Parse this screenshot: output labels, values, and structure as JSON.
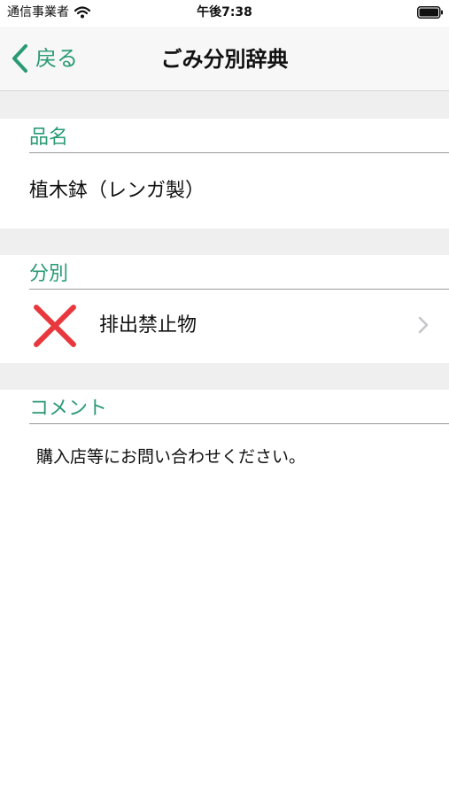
{
  "status_bar": {
    "carrier": "通信事業者",
    "time": "午後7:38"
  },
  "nav": {
    "back_label": "戻る",
    "title": "ごみ分別辞典"
  },
  "item": {
    "header": "品名",
    "name": "植木鉢（レンガ製）"
  },
  "classification": {
    "header": "分別",
    "label": "排出禁止物",
    "icon": "red-x-icon",
    "icon_color": "#e8383d"
  },
  "comment": {
    "header": "コメント",
    "text": "購入店等にお問い合わせください。"
  },
  "colors": {
    "accent": "#2a9a74",
    "section_gap": "#efefef"
  }
}
